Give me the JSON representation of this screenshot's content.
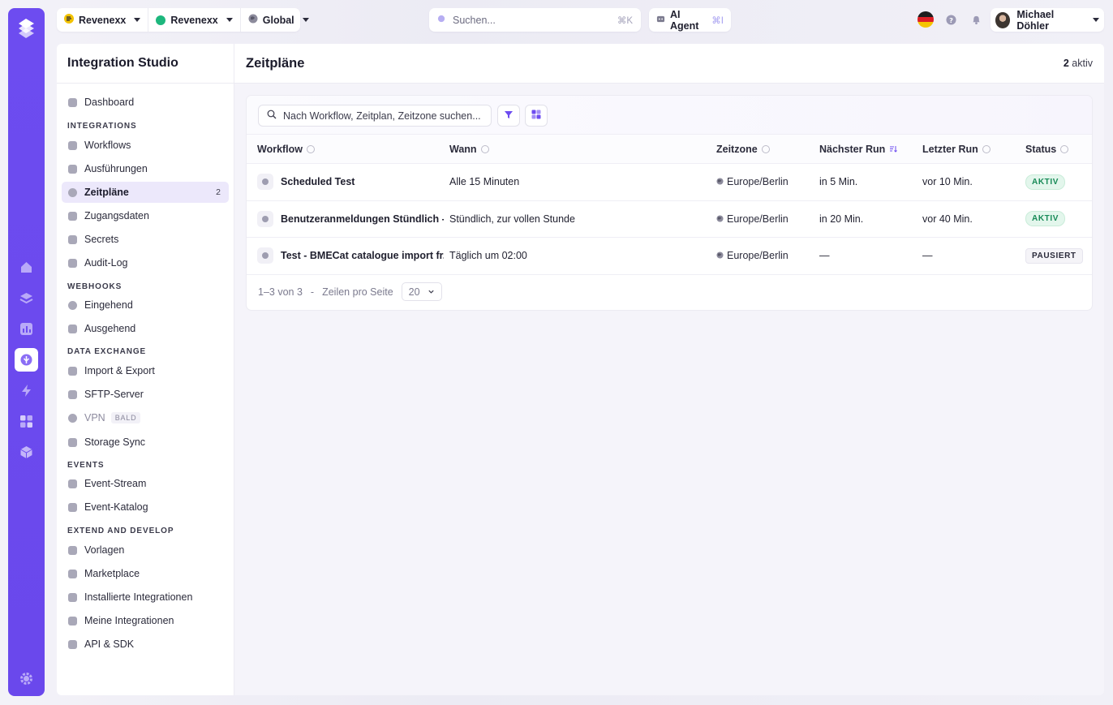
{
  "topbar": {
    "org_name": "Revenexx",
    "workspace_name": "Revenexx",
    "scope": "Global",
    "search_placeholder": "Suchen...",
    "search_shortcut": "⌘K",
    "agent_label": "AI Agent",
    "agent_shortcut": "⌘I",
    "user_name": "Michael Döhler"
  },
  "sidebar": {
    "title": "Integration Studio",
    "dashboard": "Dashboard",
    "sections": {
      "integrations": "INTEGRATIONS",
      "webhooks": "WEBHOOKS",
      "data_exchange": "DATA EXCHANGE",
      "events": "EVENTS",
      "extend": "EXTEND AND DEVELOP"
    },
    "items": {
      "workflows": "Workflows",
      "executions": "Ausführungen",
      "schedules": "Zeitpläne",
      "schedules_count": "2",
      "credentials": "Zugangsdaten",
      "secrets": "Secrets",
      "audit": "Audit-Log",
      "incoming": "Eingehend",
      "outgoing": "Ausgehend",
      "import_export": "Import & Export",
      "sftp": "SFTP-Server",
      "vpn": "VPN",
      "vpn_badge": "BALD",
      "storage": "Storage Sync",
      "event_stream": "Event-Stream",
      "event_catalog": "Event-Katalog",
      "templates": "Vorlagen",
      "marketplace": "Marketplace",
      "installed": "Installierte Integrationen",
      "mine": "Meine Integrationen",
      "api": "API & SDK"
    }
  },
  "main": {
    "title": "Zeitpläne",
    "active_count": "2",
    "active_label": "aktiv",
    "search_placeholder": "Nach Workflow, Zeitplan, Zeitzone suchen...",
    "columns": {
      "workflow": "Workflow",
      "when": "Wann",
      "timezone": "Zeitzone",
      "next_run": "Nächster Run",
      "last_run": "Letzter Run",
      "status": "Status"
    },
    "rows": [
      {
        "workflow": "Scheduled Test",
        "when": "Alle 15 Minuten",
        "timezone": "Europe/Berlin",
        "next_run": "in 5 Min.",
        "last_run": "vor 10 Min.",
        "status": "AKTIV"
      },
      {
        "workflow": "Benutzeranmeldungen Stündlich - ...",
        "when": "Stündlich, zur vollen Stunde",
        "timezone": "Europe/Berlin",
        "next_run": "in 20 Min.",
        "last_run": "vor 40 Min.",
        "status": "AKTIV"
      },
      {
        "workflow": "Test - BMECat catalogue import fr...",
        "when": "Täglich um 02:00",
        "timezone": "Europe/Berlin",
        "next_run": "—",
        "last_run": "—",
        "status": "PAUSIERT"
      }
    ],
    "pagination": {
      "range": "1–3 von 3",
      "separator": "-",
      "rows_per_page_label": "Zeilen pro Seite",
      "rows_per_page": "20"
    }
  },
  "colors": {
    "accent": "#6d4cf0",
    "status_active": "#178a57"
  }
}
